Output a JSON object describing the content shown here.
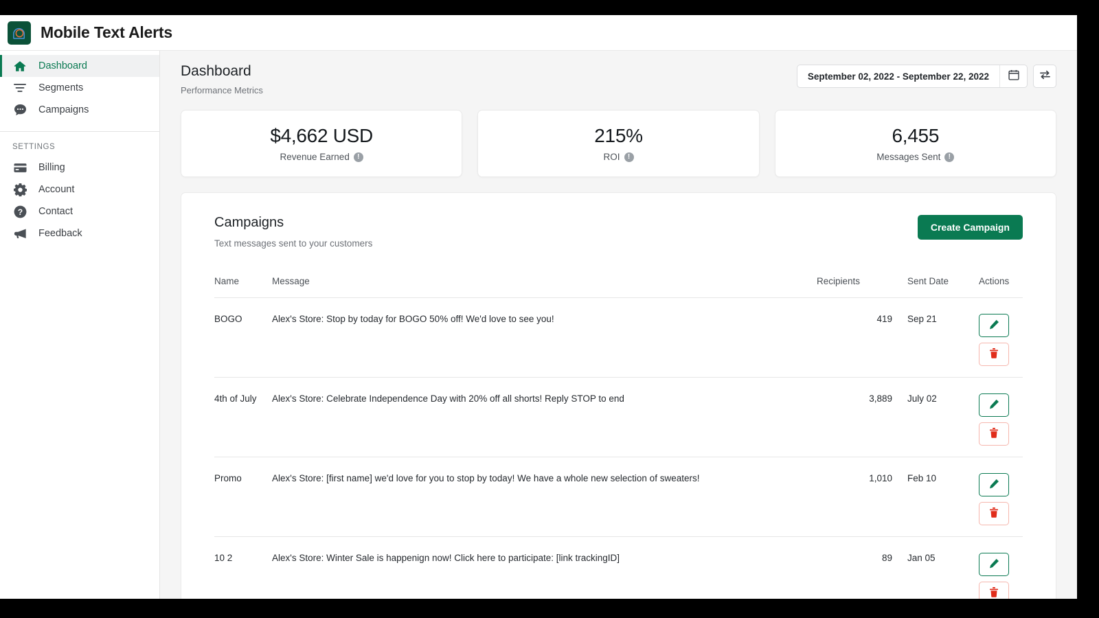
{
  "brand": {
    "title": "Mobile Text Alerts",
    "logo_icon": "speech-bubble-logo-icon",
    "logo_bg": "#0b5138"
  },
  "theme": {
    "accent_green": "#0a7a52",
    "danger_red": "#e02d1b",
    "page_bg": "#f5f5f5"
  },
  "sidebar": {
    "primary": [
      {
        "label": "Dashboard",
        "icon": "home-icon",
        "active": true
      },
      {
        "label": "Segments",
        "icon": "filter-icon",
        "active": false
      },
      {
        "label": "Campaigns",
        "icon": "chat-bubble-icon",
        "active": false
      }
    ],
    "section_label": "SETTINGS",
    "settings": [
      {
        "label": "Billing",
        "icon": "credit-card-icon"
      },
      {
        "label": "Account",
        "icon": "gear-icon"
      },
      {
        "label": "Contact",
        "icon": "question-circle-icon"
      },
      {
        "label": "Feedback",
        "icon": "megaphone-icon"
      }
    ]
  },
  "header": {
    "title": "Dashboard",
    "subtitle": "Performance Metrics",
    "date_range": "September 02, 2022 - September 22, 2022",
    "calendar_icon": "calendar-icon",
    "compare_icon": "swap-arrows-icon"
  },
  "metrics": [
    {
      "value": "$4,662 USD",
      "label": "Revenue Earned",
      "info_icon": "info-icon",
      "info_glyph": "!"
    },
    {
      "value": "215%",
      "label": "ROI",
      "info_icon": "info-icon",
      "info_glyph": "!"
    },
    {
      "value": "6,455",
      "label": "Messages Sent",
      "info_icon": "info-icon",
      "info_glyph": "!"
    }
  ],
  "campaigns_panel": {
    "title": "Campaigns",
    "subtitle": "Text messages sent to your customers",
    "create_button": "Create Campaign",
    "columns": [
      "Name",
      "Message",
      "Recipients",
      "Sent Date",
      "Actions"
    ],
    "rows": [
      {
        "name": "BOGO",
        "message": "Alex's Store: Stop by today for BOGO 50% off! We'd love to see you!",
        "recipients": "419",
        "sent_date": "Sep 21",
        "edit_icon": "pencil-icon",
        "delete_icon": "trash-icon"
      },
      {
        "name": "4th of July",
        "message": "Alex's Store: Celebrate Independence Day with 20% off all shorts! Reply STOP to end",
        "recipients": "3,889",
        "sent_date": "July 02",
        "edit_icon": "pencil-icon",
        "delete_icon": "trash-icon"
      },
      {
        "name": "Promo",
        "message": "Alex's Store: [first name] we'd love for you to stop by today! We have a whole new selection of sweaters!",
        "recipients": "1,010",
        "sent_date": "Feb 10",
        "edit_icon": "pencil-icon",
        "delete_icon": "trash-icon"
      },
      {
        "name": "10 2",
        "message": "Alex's Store: Winter Sale is happenign now! Click here to participate: [link trackingID]",
        "recipients": "89",
        "sent_date": "Jan 05",
        "edit_icon": "pencil-icon",
        "delete_icon": "trash-icon"
      }
    ]
  }
}
